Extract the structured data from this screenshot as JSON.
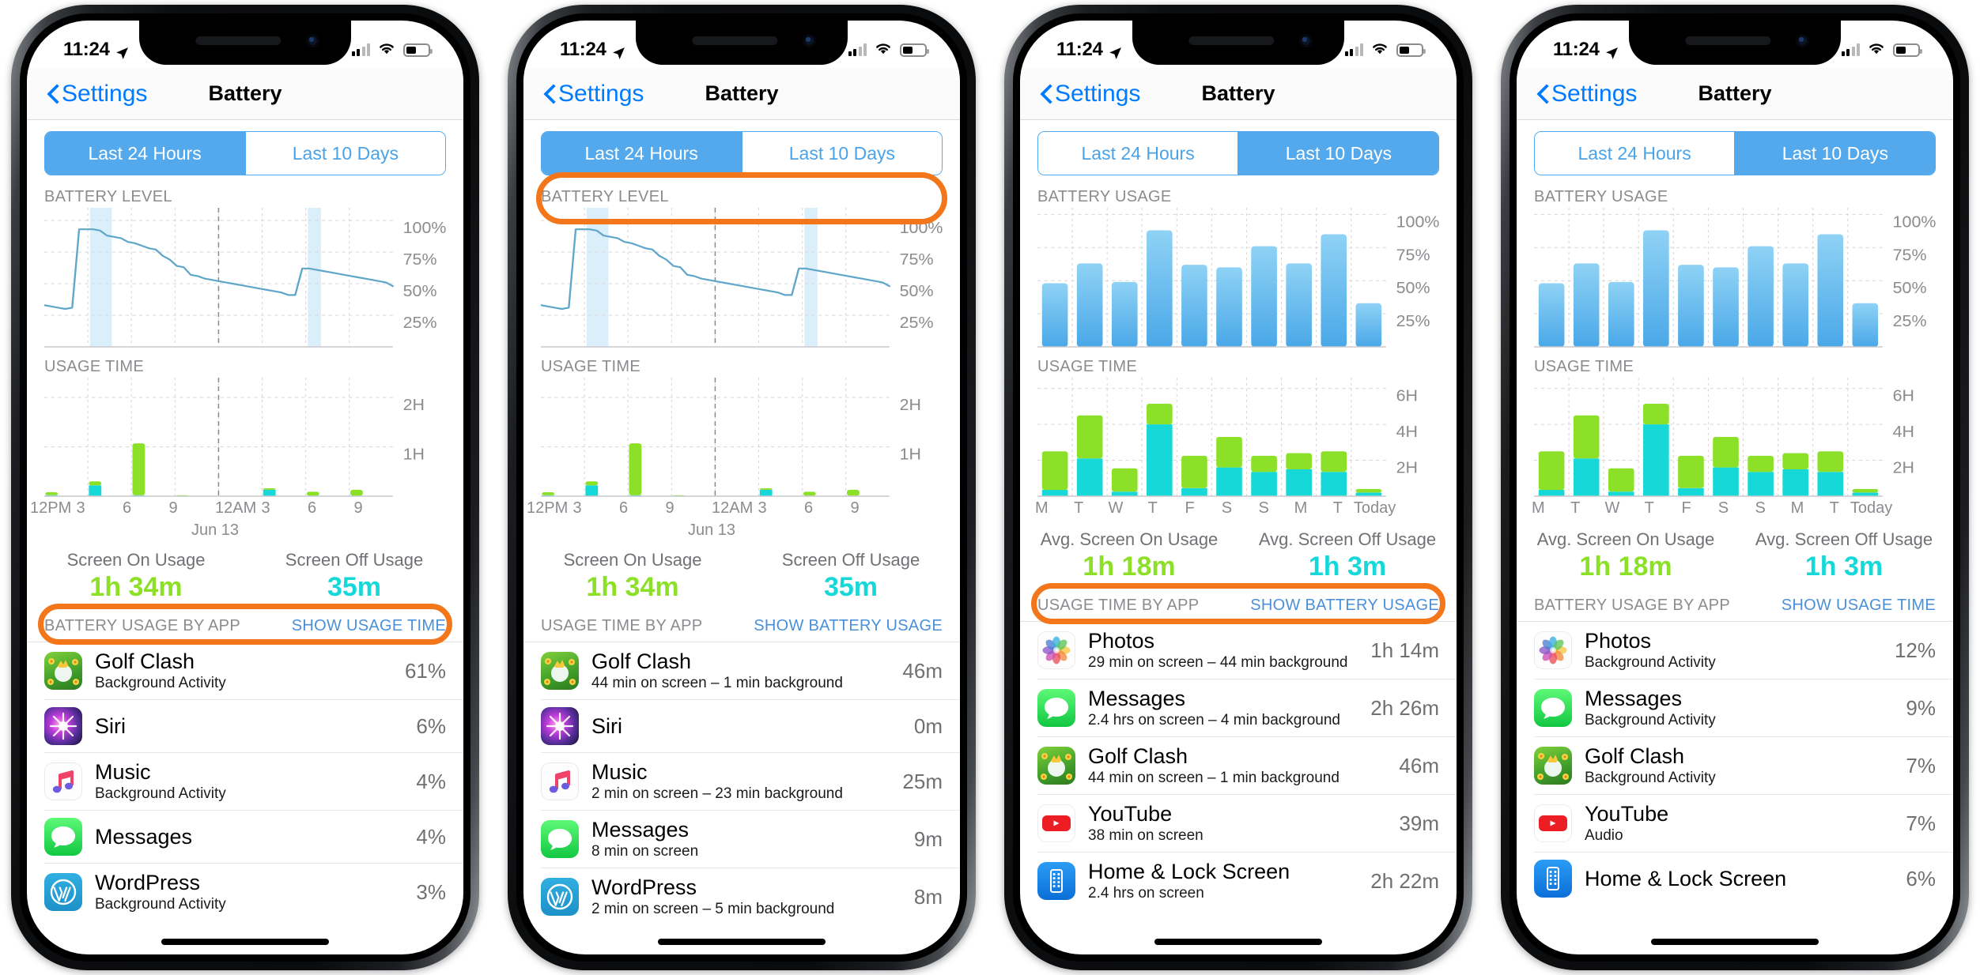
{
  "phones": [
    {
      "status": {
        "time": "11:24",
        "location_icon": "location-arrow-icon",
        "wifi_icon": "wifi-icon",
        "battery_icon": "battery-icon",
        "signal_icon": "cellular-signal-icon"
      },
      "nav": {
        "back_label": "Settings",
        "title": "Battery",
        "back_icon": "chevron-left-icon"
      },
      "segmented": {
        "options": [
          "Last 24 Hours",
          "Last 10 Days"
        ],
        "selected": "Last 24 Hours"
      },
      "chart_top_label": "BATTERY LEVEL",
      "chart_bottom_label": "USAGE TIME",
      "x_axis": [
        "12PM",
        "3",
        "6",
        "9",
        "12AM",
        "3",
        "6",
        "9"
      ],
      "x_axis_note": "Jun 13",
      "summary": [
        {
          "title": "Screen On Usage",
          "value": "1h 34m",
          "color": "#8ce028"
        },
        {
          "title": "Screen Off Usage",
          "value": "35m",
          "color": "#16d8d8"
        }
      ],
      "list_header": {
        "label": "BATTERY USAGE BY APP",
        "action": "SHOW USAGE TIME"
      },
      "apps": [
        {
          "name": "Golf Clash",
          "sub": "Background Activity",
          "value": "61%",
          "icon": "golf-clash-icon"
        },
        {
          "name": "Siri",
          "sub": "",
          "value": "6%",
          "icon": "siri-icon"
        },
        {
          "name": "Music",
          "sub": "Background Activity",
          "value": "4%",
          "icon": "music-icon"
        },
        {
          "name": "Messages",
          "sub": "",
          "value": "4%",
          "icon": "messages-icon"
        },
        {
          "name": "WordPress",
          "sub": "Background Activity",
          "value": "3%",
          "icon": "wordpress-icon"
        }
      ],
      "highlight": "list-header"
    },
    {
      "status": {
        "time": "11:24",
        "location_icon": "location-arrow-icon",
        "wifi_icon": "wifi-icon",
        "battery_icon": "battery-icon",
        "signal_icon": "cellular-signal-icon"
      },
      "nav": {
        "back_label": "Settings",
        "title": "Battery",
        "back_icon": "chevron-left-icon"
      },
      "segmented": {
        "options": [
          "Last 24 Hours",
          "Last 10 Days"
        ],
        "selected": "Last 24 Hours"
      },
      "chart_top_label": "BATTERY LEVEL",
      "chart_bottom_label": "USAGE TIME",
      "x_axis": [
        "12PM",
        "3",
        "6",
        "9",
        "12AM",
        "3",
        "6",
        "9"
      ],
      "x_axis_note": "Jun 13",
      "summary": [
        {
          "title": "Screen On Usage",
          "value": "1h 34m",
          "color": "#8ce028"
        },
        {
          "title": "Screen Off Usage",
          "value": "35m",
          "color": "#16d8d8"
        }
      ],
      "list_header": {
        "label": "USAGE TIME BY APP",
        "action": "SHOW BATTERY USAGE"
      },
      "apps": [
        {
          "name": "Golf Clash",
          "sub": "44 min on screen – 1 min background",
          "value": "46m",
          "icon": "golf-clash-icon"
        },
        {
          "name": "Siri",
          "sub": "",
          "value": "0m",
          "icon": "siri-icon"
        },
        {
          "name": "Music",
          "sub": "2 min on screen – 23 min background",
          "value": "25m",
          "icon": "music-icon"
        },
        {
          "name": "Messages",
          "sub": "8 min on screen",
          "value": "9m",
          "icon": "messages-icon"
        },
        {
          "name": "WordPress",
          "sub": "2 min on screen – 5 min background",
          "value": "8m",
          "icon": "wordpress-icon"
        }
      ],
      "highlight": "segmented"
    },
    {
      "status": {
        "time": "11:24",
        "location_icon": "location-arrow-icon",
        "wifi_icon": "wifi-icon",
        "battery_icon": "battery-icon",
        "signal_icon": "cellular-signal-icon"
      },
      "nav": {
        "back_label": "Settings",
        "title": "Battery",
        "back_icon": "chevron-left-icon"
      },
      "segmented": {
        "options": [
          "Last 24 Hours",
          "Last 10 Days"
        ],
        "selected": "Last 10 Days"
      },
      "chart_top_label": "BATTERY USAGE",
      "chart_bottom_label": "USAGE TIME",
      "x_axis": [
        "M",
        "T",
        "W",
        "T",
        "F",
        "S",
        "S",
        "M",
        "T",
        "Today"
      ],
      "x_axis_note": "",
      "summary": [
        {
          "title": "Avg. Screen On Usage",
          "value": "1h 18m",
          "color": "#8ce028"
        },
        {
          "title": "Avg. Screen Off Usage",
          "value": "1h 3m",
          "color": "#16d8d8"
        }
      ],
      "list_header": {
        "label": "USAGE TIME BY APP",
        "action": "SHOW BATTERY USAGE"
      },
      "apps": [
        {
          "name": "Photos",
          "sub": "29 min on screen – 44 min background",
          "value": "1h 14m",
          "icon": "photos-icon"
        },
        {
          "name": "Messages",
          "sub": "2.4 hrs on screen – 4 min background",
          "value": "2h 26m",
          "icon": "messages-icon"
        },
        {
          "name": "Golf Clash",
          "sub": "44 min on screen – 1 min background",
          "value": "46m",
          "icon": "golf-clash-icon"
        },
        {
          "name": "YouTube",
          "sub": "38 min on screen",
          "value": "39m",
          "icon": "youtube-icon"
        },
        {
          "name": "Home & Lock Screen",
          "sub": "2.4 hrs on screen",
          "value": "2h 22m",
          "icon": "home-lock-screen-icon"
        }
      ],
      "highlight": "list-header"
    },
    {
      "status": {
        "time": "11:24",
        "location_icon": "location-arrow-icon",
        "wifi_icon": "wifi-icon",
        "battery_icon": "battery-icon",
        "signal_icon": "cellular-signal-icon"
      },
      "nav": {
        "back_label": "Settings",
        "title": "Battery",
        "back_icon": "chevron-left-icon"
      },
      "segmented": {
        "options": [
          "Last 24 Hours",
          "Last 10 Days"
        ],
        "selected": "Last 10 Days"
      },
      "chart_top_label": "BATTERY USAGE",
      "chart_bottom_label": "USAGE TIME",
      "x_axis": [
        "M",
        "T",
        "W",
        "T",
        "F",
        "S",
        "S",
        "M",
        "T",
        "Today"
      ],
      "x_axis_note": "",
      "summary": [
        {
          "title": "Avg. Screen On Usage",
          "value": "1h 18m",
          "color": "#8ce028"
        },
        {
          "title": "Avg. Screen Off Usage",
          "value": "1h 3m",
          "color": "#16d8d8"
        }
      ],
      "list_header": {
        "label": "BATTERY USAGE BY APP",
        "action": "SHOW USAGE TIME"
      },
      "apps": [
        {
          "name": "Photos",
          "sub": "Background Activity",
          "value": "12%",
          "icon": "photos-icon"
        },
        {
          "name": "Messages",
          "sub": "Background Activity",
          "value": "9%",
          "icon": "messages-icon"
        },
        {
          "name": "Golf Clash",
          "sub": "Background Activity",
          "value": "7%",
          "icon": "golf-clash-icon"
        },
        {
          "name": "YouTube",
          "sub": "Audio",
          "value": "7%",
          "icon": "youtube-icon"
        },
        {
          "name": "Home & Lock Screen",
          "sub": "",
          "value": "6%",
          "icon": "home-lock-screen-icon"
        }
      ],
      "highlight": "none"
    }
  ],
  "chart_data": [
    {
      "type": "line",
      "title": "BATTERY LEVEL",
      "xlabel": "",
      "ylabel": "",
      "ylim": [
        0,
        110
      ],
      "yticks": [
        25,
        50,
        75,
        100
      ],
      "ytick_labels": [
        "25%",
        "50%",
        "75%",
        "100%"
      ],
      "x": [
        "12PM",
        "3",
        "6",
        "9",
        "12AM",
        "3",
        "6",
        "9"
      ],
      "grid": true,
      "charging_bands": [
        [
          1.05,
          1.55
        ],
        [
          6.05,
          6.35
        ]
      ],
      "values": [
        33,
        32,
        31,
        30,
        31,
        93,
        93,
        93,
        92,
        88,
        87,
        86,
        83,
        82,
        80,
        78,
        77,
        72,
        69,
        64,
        63,
        57,
        56,
        54,
        53,
        52,
        51,
        50,
        49,
        48,
        47,
        46,
        45,
        44,
        43,
        41,
        41,
        62,
        62,
        61,
        60,
        59,
        58,
        57,
        56,
        55,
        54,
        53,
        52,
        51,
        48
      ]
    },
    {
      "type": "bar",
      "title": "USAGE TIME (24h)",
      "xlabel": "",
      "ylabel": "",
      "ylim": [
        0,
        2.4
      ],
      "yticks": [
        1,
        2
      ],
      "ytick_labels": [
        "1H",
        "2H"
      ],
      "categories": [
        "12PM",
        "1PM",
        "2PM",
        "3PM",
        "4PM",
        "5PM",
        "6PM",
        "7PM",
        "8PM",
        "9PM",
        "10PM",
        "11PM",
        "12AM",
        "1AM",
        "2AM",
        "3AM",
        "4AM",
        "5AM",
        "6AM",
        "7AM",
        "8AM",
        "9AM",
        "10AM",
        "11AM"
      ],
      "series": [
        {
          "name": "Screen On (cyan)",
          "color": "#16d8d8",
          "values": [
            0.02,
            0,
            0,
            0.22,
            0,
            0,
            0.02,
            0,
            0,
            0,
            0,
            0,
            0,
            0,
            0,
            0.13,
            0,
            0,
            0.01,
            0,
            0,
            0.01,
            0,
            0
          ]
        },
        {
          "name": "Screen Off (green)",
          "color": "#8ce028",
          "values": [
            0.06,
            0,
            0,
            0.08,
            0,
            0,
            1.05,
            0,
            0,
            0.02,
            0,
            0,
            0,
            0,
            0,
            0.03,
            0,
            0,
            0.08,
            0,
            0,
            0.12,
            0,
            0
          ]
        }
      ]
    },
    {
      "type": "bar",
      "title": "BATTERY USAGE (10 days)",
      "xlabel": "",
      "ylabel": "",
      "ylim": [
        0,
        105
      ],
      "yticks": [
        25,
        50,
        75,
        100
      ],
      "ytick_labels": [
        "25%",
        "50%",
        "75%",
        "100%"
      ],
      "categories": [
        "M",
        "T",
        "W",
        "T",
        "F",
        "S",
        "S",
        "M",
        "T",
        "Today"
      ],
      "values": [
        48,
        63,
        49,
        88,
        62,
        60,
        76,
        63,
        85,
        33
      ],
      "color": "#5cb3ee"
    },
    {
      "type": "bar",
      "title": "USAGE TIME (10 days)",
      "xlabel": "",
      "ylabel": "",
      "ylim": [
        0,
        6.6
      ],
      "yticks": [
        2,
        4,
        6
      ],
      "ytick_labels": [
        "2H",
        "4H",
        "6H"
      ],
      "categories": [
        "M",
        "T",
        "W",
        "T",
        "F",
        "S",
        "S",
        "M",
        "T",
        "Today"
      ],
      "series": [
        {
          "name": "Screen On (cyan)",
          "color": "#16d8d8",
          "values": [
            0.35,
            2.1,
            0.25,
            4.0,
            0.45,
            1.6,
            1.35,
            1.5,
            1.35,
            0.2
          ]
        },
        {
          "name": "Screen Off (green)",
          "color": "#8ce028",
          "values": [
            2.15,
            2.4,
            1.3,
            1.15,
            1.8,
            1.7,
            0.9,
            0.9,
            1.15,
            0.2
          ]
        }
      ]
    }
  ]
}
